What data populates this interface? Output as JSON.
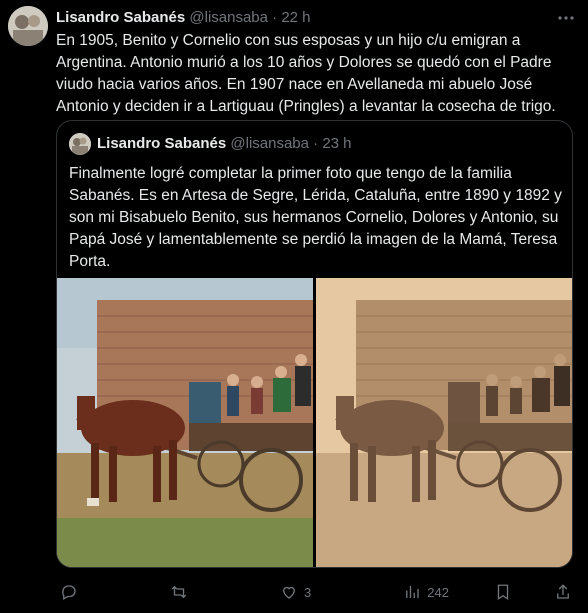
{
  "tweet": {
    "author_name": "Lisandro Sabanés",
    "author_meta": "@lisansaba · 22 h",
    "text": "En 1905, Benito y Cornelio con sus esposas y un hijo c/u emigran a Argentina. Antonio murió a los 10 años y Dolores se quedó con el Padre viudo hacia varios años. En 1907 nace en Avellaneda mi abuelo José Antonio y deciden ir a Lartiguau (Pringles) a levantar la cosecha de trigo."
  },
  "quoted": {
    "author_name": "Lisandro Sabanés",
    "author_meta": "@lisansaba · 23 h",
    "text": "Finalmente logré completar la primer foto que tengo de la familia Sabanés. Es en Artesa de Segre, Lérida, Cataluña, entre 1890 y 1892 y son mi Bisabuelo Benito, sus hermanos Cornelio, Dolores y Antonio, su Papá José y lamentablemente se perdió la imagen de la Mamá, Teresa Porta."
  },
  "actions": {
    "reply_icon": "reply-icon",
    "retweet_icon": "retweet-icon",
    "like_count": "3",
    "views_count": "242"
  }
}
